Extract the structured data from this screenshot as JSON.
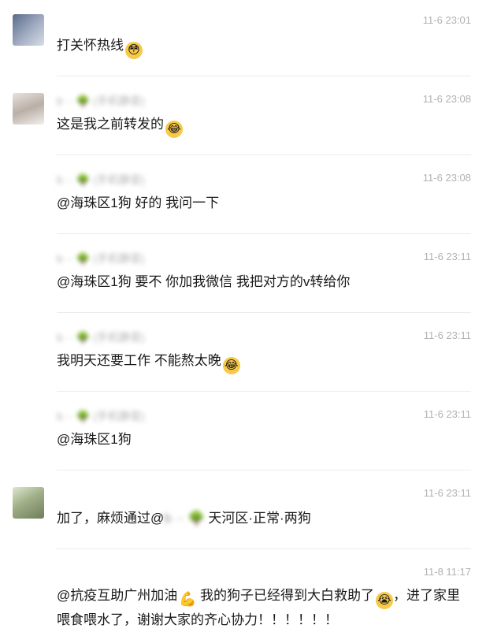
{
  "messages": [
    {
      "name": "",
      "time": "11-6 23:01",
      "text": "打关怀热线",
      "emoji": "😳"
    },
    {
      "name": "b ·· 🌳 (手机静音)",
      "time": "11-6 23:08",
      "text": "这是我之前转发的",
      "emoji": "😂"
    },
    {
      "name": "b ·· 🌳 (手机静音)",
      "time": "11-6 23:08",
      "text": "@海珠区1狗 好的 我问一下"
    },
    {
      "name": "b ·· 🌳 (手机静音)",
      "time": "11-6 23:11",
      "text": "@海珠区1狗 要不 你加我微信 我把对方的v转给你"
    },
    {
      "name": "b ·· 🌳 (手机静音)",
      "time": "11-6 23:11",
      "text": "我明天还要工作 不能熬太晚",
      "emoji": "😂"
    },
    {
      "name": "b ·· 🌳 (手机静音)",
      "time": "11-6 23:11",
      "text": "@海珠区1狗"
    },
    {
      "name": "",
      "time": "11-6 23:11",
      "text_before": "加了，麻烦通过@",
      "text_blurred": "b ·· 🌳",
      "text_after": " 天河区·正常·两狗"
    },
    {
      "name": "",
      "time": "11-8 11:17",
      "text_part1": "@抗疫互助广州加油",
      "text_part2": " 我的狗子已经得到大白救助了",
      "text_part3": "，进了家里喂食喂水了，谢谢大家的齐心协力！！！！！！",
      "emoji": "😭"
    }
  ],
  "colors": {
    "timestamp": "#b2b2b2",
    "text": "#191919",
    "divider": "#ececec"
  }
}
